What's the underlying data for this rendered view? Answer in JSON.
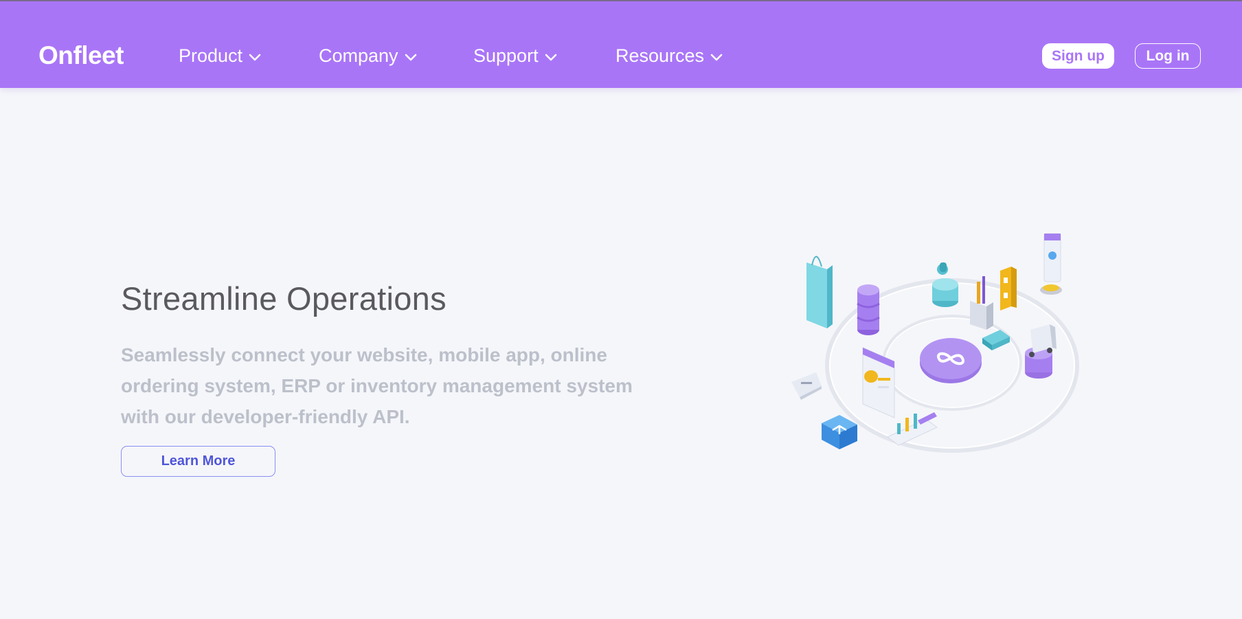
{
  "brand": {
    "name": "Onfleet"
  },
  "nav": {
    "items": [
      {
        "label": "Product"
      },
      {
        "label": "Company"
      },
      {
        "label": "Support"
      },
      {
        "label": "Resources"
      }
    ],
    "signup_label": "Sign up",
    "login_label": "Log in"
  },
  "hero": {
    "title": "Streamline Operations",
    "description": "Seamlessly connect your website, mobile app, online ordering system, ERP or inventory management system with our developer-friendly API.",
    "cta_label": "Learn More"
  },
  "colors": {
    "brand_purple": "#a975f7",
    "background": "#f5f6fa",
    "title_gray": "#5a5a5e",
    "description_gray": "#bcc0ca",
    "link_blue": "#4f56d8"
  },
  "icons": [
    "chevron-down-icon",
    "shopping-bag-icon",
    "database-icon",
    "scooter-icon",
    "tools-icon",
    "warehouse-icon",
    "phone-rating-icon",
    "truck-icon",
    "chat-bubble-icon",
    "magento-icon",
    "dashboard-chart-icon",
    "infinity-hub-icon"
  ]
}
